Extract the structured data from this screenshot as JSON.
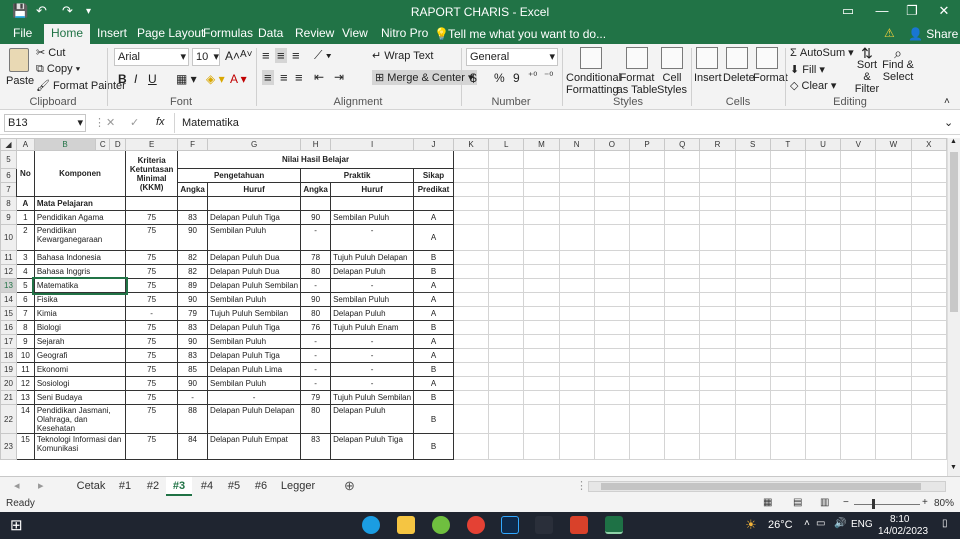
{
  "title_bar": {
    "title": "RAPORT CHARIS - Excel",
    "controls": [
      "▭",
      "—",
      "❐",
      "✕"
    ]
  },
  "quick_access": {
    "save": "💾",
    "undo": "↶",
    "redo": "↷",
    "customize": "▾"
  },
  "ribbon_tabs": [
    "File",
    "Home",
    "Insert",
    "Page Layout",
    "Formulas",
    "Data",
    "Review",
    "View",
    "Nitro Pro"
  ],
  "tell_me": "Tell me what you want to do...",
  "share": "Share",
  "clipboard": {
    "paste": "Paste",
    "cut": "Cut",
    "copy": "Copy",
    "format_painter": "Format Painter",
    "group": "Clipboard"
  },
  "font": {
    "name": "Arial",
    "size": "10",
    "grow": "A˄",
    "shrink": "A˅",
    "bold": "B",
    "italic": "I",
    "underline": "U",
    "group": "Font"
  },
  "alignment": {
    "wrap_text": "Wrap Text",
    "merge_center": "Merge & Center",
    "group": "Alignment"
  },
  "number": {
    "format": "General",
    "currency": "$",
    "percent": "%",
    "comma": "9",
    "group": "Number"
  },
  "styles": {
    "conditional": "Conditional Formatting",
    "format_table": "Format as Table",
    "cell_styles": "Cell Styles",
    "group": "Styles"
  },
  "cells": {
    "insert": "Insert",
    "delete": "Delete",
    "format": "Format",
    "group": "Cells"
  },
  "editing": {
    "autosum": "AutoSum",
    "fill": "Fill",
    "clear": "Clear",
    "sort_filter": "Sort & Filter",
    "find_select": "Find & Select",
    "group": "Editing"
  },
  "formula_bar": {
    "name_box": "B13",
    "fx": "fx",
    "cancel": "✕",
    "enter": "✓",
    "content": "Matematika"
  },
  "columns": [
    "A",
    "B",
    "C",
    "D",
    "E",
    "F",
    "G",
    "H",
    "I",
    "J",
    "K",
    "L",
    "M",
    "N",
    "O",
    "P",
    "Q",
    "R",
    "S",
    "T",
    "U",
    "V",
    "W",
    "X"
  ],
  "header": {
    "no": "No",
    "komponen": "Komponen",
    "kkm": "Kriteria Ketuntasan Minimal (KKM)",
    "nilai": "Nilai Hasil Belajar",
    "pengetahuan": "Pengetahuan",
    "praktik": "Praktik",
    "sikap": "Sikap",
    "angka": "Angka",
    "huruf": "Huruf",
    "angka2": "Angka",
    "huruf2": "Huruf",
    "predikat": "Predikat",
    "section_letter": "A",
    "section_title": "Mata Pelajaran"
  },
  "row_numbers": {
    "r5": "5",
    "r6": "6",
    "r7": "7",
    "r8": "8"
  },
  "rows": [
    {
      "r": "9",
      "no": "1",
      "name": "Pendidikan Agama",
      "kkm": "75",
      "pa": "83",
      "ph": "Delapan Puluh Tiga",
      "ka": "90",
      "kh": "Sembilan Puluh",
      "pred": "A",
      "tall": false
    },
    {
      "r": "10",
      "no": "2",
      "name": "Pendidikan Kewarganegaraan",
      "kkm": "75",
      "pa": "90",
      "ph": "Sembilan Puluh",
      "ka": "-",
      "kh": "-",
      "pred": "A",
      "tall": true
    },
    {
      "r": "11",
      "no": "3",
      "name": "Bahasa Indonesia",
      "kkm": "75",
      "pa": "82",
      "ph": "Delapan Puluh Dua",
      "ka": "78",
      "kh": "Tujuh Puluh Delapan",
      "pred": "B",
      "tall": false
    },
    {
      "r": "12",
      "no": "4",
      "name": "Bahasa Inggris",
      "kkm": "75",
      "pa": "82",
      "ph": "Delapan Puluh Dua",
      "ka": "80",
      "kh": "Delapan Puluh",
      "pred": "B",
      "tall": false
    },
    {
      "r": "13",
      "no": "5",
      "name": "Matematika",
      "kkm": "75",
      "pa": "89",
      "ph": "Delapan Puluh Sembilan",
      "ka": "-",
      "kh": "-",
      "pred": "A",
      "tall": false
    },
    {
      "r": "14",
      "no": "6",
      "name": "Fisika",
      "kkm": "75",
      "pa": "90",
      "ph": "Sembilan Puluh",
      "ka": "90",
      "kh": "Sembilan Puluh",
      "pred": "A",
      "tall": false
    },
    {
      "r": "15",
      "no": "7",
      "name": "Kimia",
      "kkm": "-",
      "pa": "79",
      "ph": "Tujuh Puluh Sembilan",
      "ka": "80",
      "kh": "Delapan Puluh",
      "pred": "A",
      "tall": false
    },
    {
      "r": "16",
      "no": "8",
      "name": "Biologi",
      "kkm": "75",
      "pa": "83",
      "ph": "Delapan Puluh Tiga",
      "ka": "76",
      "kh": "Tujuh Puluh Enam",
      "pred": "B",
      "tall": false
    },
    {
      "r": "17",
      "no": "9",
      "name": "Sejarah",
      "kkm": "75",
      "pa": "90",
      "ph": "Sembilan Puluh",
      "ka": "-",
      "kh": "-",
      "pred": "A",
      "tall": false
    },
    {
      "r": "18",
      "no": "10",
      "name": "Geografi",
      "kkm": "75",
      "pa": "83",
      "ph": "Delapan Puluh Tiga",
      "ka": "-",
      "kh": "-",
      "pred": "A",
      "tall": false
    },
    {
      "r": "19",
      "no": "11",
      "name": "Ekonomi",
      "kkm": "75",
      "pa": "85",
      "ph": "Delapan Puluh Lima",
      "ka": "-",
      "kh": "-",
      "pred": "B",
      "tall": false
    },
    {
      "r": "20",
      "no": "12",
      "name": "Sosiologi",
      "kkm": "75",
      "pa": "90",
      "ph": "Sembilan Puluh",
      "ka": "-",
      "kh": "-",
      "pred": "A",
      "tall": false
    },
    {
      "r": "21",
      "no": "13",
      "name": "Seni Budaya",
      "kkm": "75",
      "pa": "-",
      "ph": "-",
      "ka": "79",
      "kh": "Tujuh Puluh Sembilan",
      "pred": "B",
      "tall": false
    },
    {
      "r": "22",
      "no": "14",
      "name": "Pendidikan Jasmani, Olahraga, dan Kesehatan",
      "kkm": "75",
      "pa": "88",
      "ph": "Delapan Puluh Delapan",
      "ka": "80",
      "kh": "Delapan Puluh",
      "pred": "B",
      "tall": true
    },
    {
      "r": "23",
      "no": "15",
      "name": "Teknologi Informasi dan Komunikasi",
      "kkm": "75",
      "pa": "84",
      "ph": "Delapan Puluh Empat",
      "ka": "83",
      "kh": "Delapan Puluh Tiga",
      "pred": "B",
      "tall": true
    }
  ],
  "sheet_tabs": [
    "Cetak",
    "#1",
    "#2",
    "#3",
    "#4",
    "#5",
    "#6",
    "Legger"
  ],
  "active_sheet": "#3",
  "status": {
    "ready": "Ready",
    "zoom": "80%"
  },
  "taskbar": {
    "weather": "26°C",
    "lang": "ENG",
    "time": "8:10",
    "date": "14/02/2023"
  }
}
